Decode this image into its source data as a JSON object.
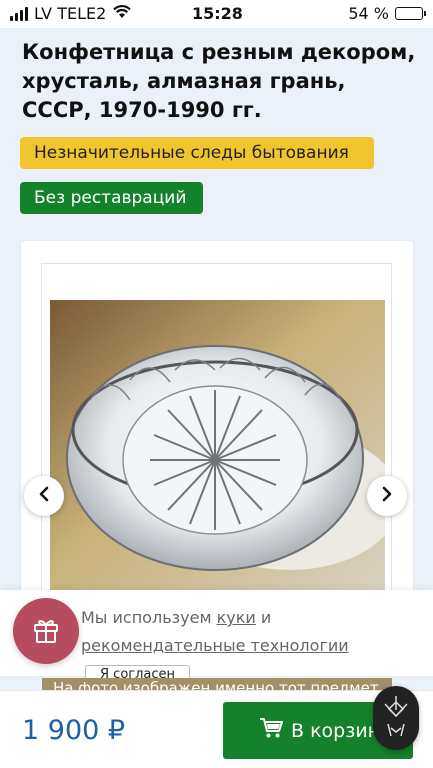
{
  "status_bar": {
    "carrier": "LV TELE2",
    "time": "15:28",
    "battery_percent": "54 %",
    "battery_level": 0.54,
    "icons": [
      "cellular-signal-icon",
      "wifi-icon",
      "battery-icon"
    ]
  },
  "product": {
    "title": "Конфетница с резным декором, хрусталь, алмазная грань, СССР, 1970-1990 гг.",
    "badges": {
      "condition": "Незначительные следы бытования",
      "restoration": "Без реставраций"
    },
    "photo_note": "На фото изображен именно тот предмет"
  },
  "gallery": {
    "prev_icon": "chevron-left-icon",
    "next_icon": "chevron-right-icon"
  },
  "cookie_banner": {
    "text_before": "Мы используем",
    "link_cookies": "куки",
    "text_and": "и",
    "link_recommendations": "рекомендательные технологии",
    "agree_label": "Я согласен",
    "gift_icon": "gift-icon"
  },
  "bottom_bar": {
    "price": "1 900 ₽",
    "cart_label": "В корзину",
    "cart_icon": "cart-icon",
    "logo_icon": "brand-logo-icon"
  },
  "colors": {
    "price": "#1d5fa8",
    "badge_condition": "#f0c52e",
    "badge_restoration": "#14822a",
    "cart_button": "#14822a",
    "gift_fab": "#b74c60"
  }
}
